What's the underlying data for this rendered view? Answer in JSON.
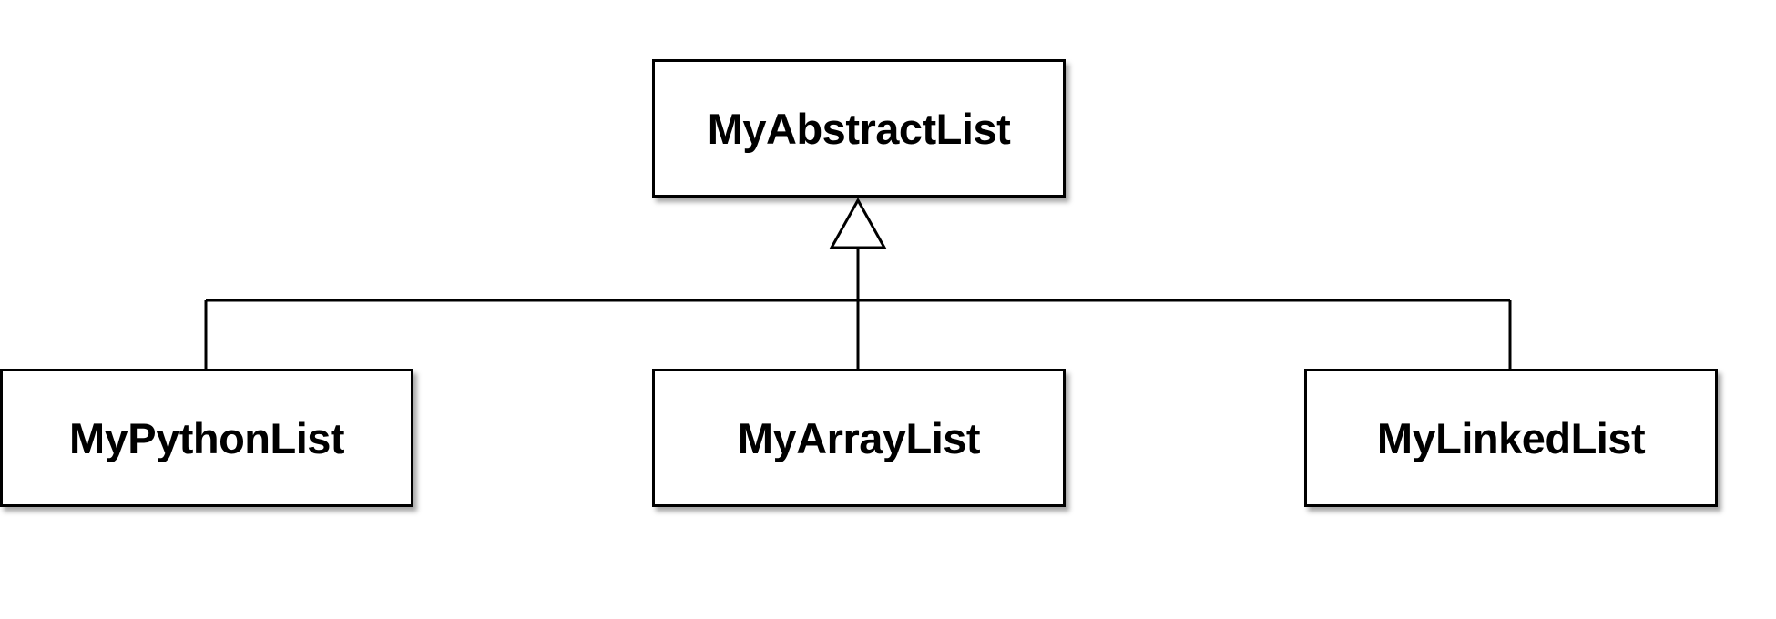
{
  "diagram": {
    "type": "uml-inheritance",
    "parent": {
      "label": "MyAbstractList"
    },
    "children": [
      {
        "label": "MyPythonList"
      },
      {
        "label": "MyArrayList"
      },
      {
        "label": "MyLinkedList"
      }
    ],
    "colors": {
      "stroke": "#000000",
      "fill": "#ffffff"
    }
  }
}
